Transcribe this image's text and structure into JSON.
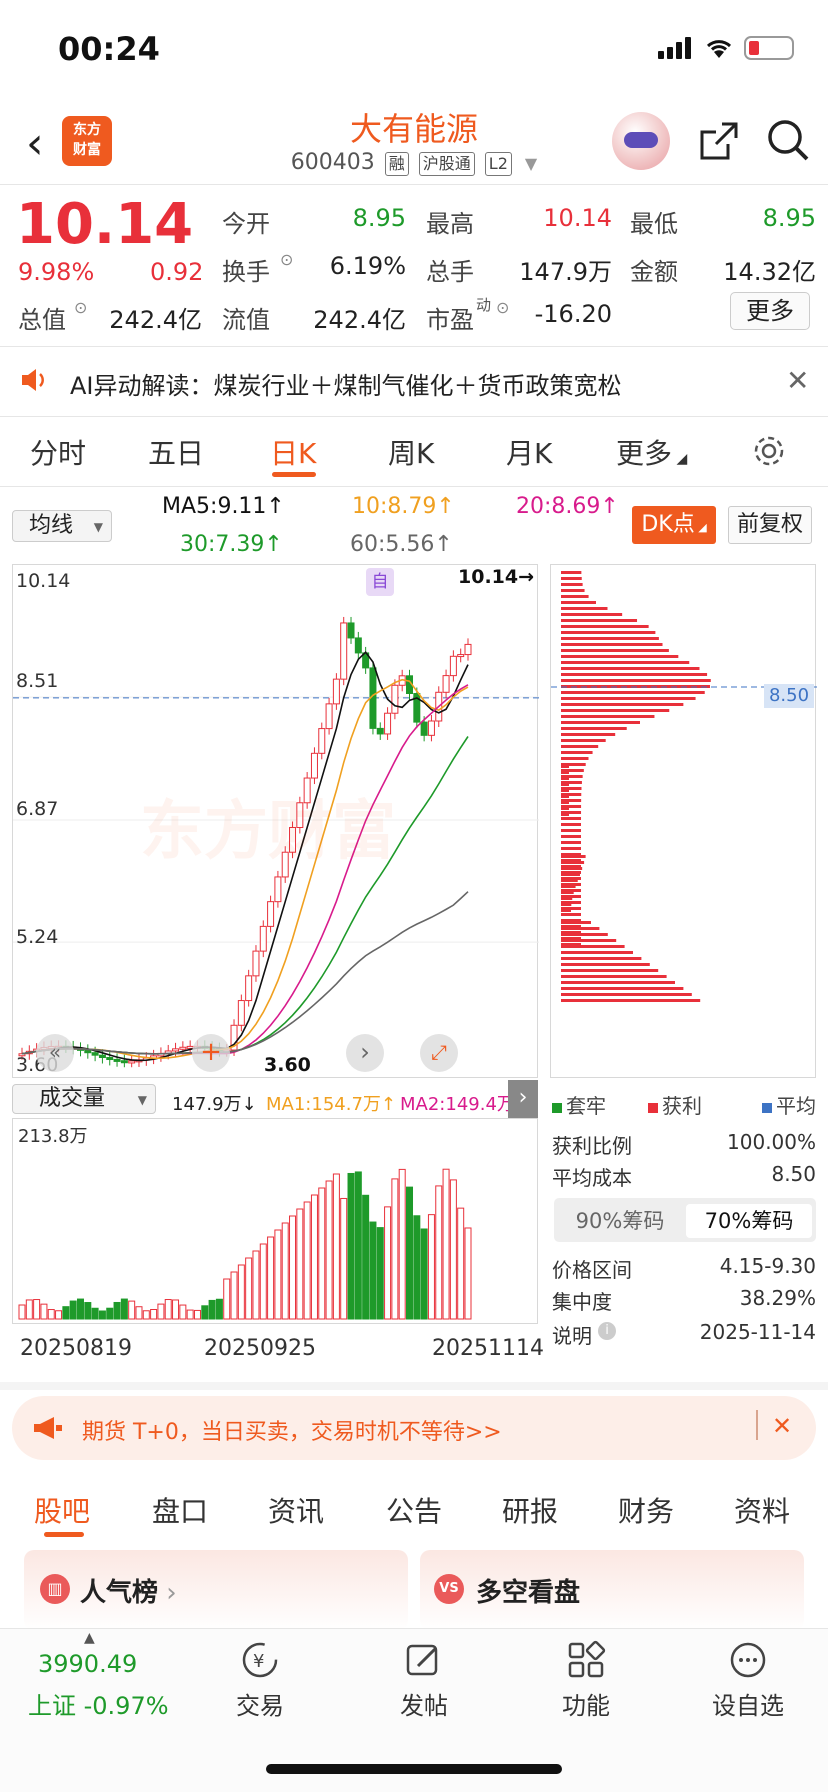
{
  "status": {
    "time": "00:24"
  },
  "header": {
    "logo_text": "东方\n财富",
    "stock_name": "大有能源",
    "stock_code": "600403",
    "tags": [
      "融",
      "沪股通",
      "L2"
    ]
  },
  "quote": {
    "price": "10.14",
    "pct": "9.98%",
    "change": "0.92",
    "open_label": "今开",
    "open": "8.95",
    "high_label": "最高",
    "high": "10.14",
    "low_label": "最低",
    "low": "8.95",
    "turnover_label": "换手",
    "turnover": "6.19%",
    "volume_label": "总手",
    "volume": "147.9万",
    "amount_label": "金额",
    "amount": "14.32亿",
    "mktcap_label": "总值",
    "mktcap": "242.4亿",
    "float_label": "流值",
    "float": "242.4亿",
    "pe_label": "市盈",
    "pe_sup": "动",
    "pe": "-16.20",
    "more_label": "更多"
  },
  "ai_banner": {
    "text": "AI异动解读：煤炭行业＋煤制气催化＋货币政策宽松"
  },
  "kline_tabs": [
    "分时",
    "五日",
    "日K",
    "周K",
    "月K",
    "更多"
  ],
  "ma": {
    "select": "均线",
    "ma5": "MA5:9.11↑",
    "ma10": "10:8.79↑",
    "ma20": "20:8.69↑",
    "ma30": "30:7.39↑",
    "ma60": "60:5.56↑",
    "dk_label": "DK点",
    "fq_label": "前复权"
  },
  "kchart": {
    "y_ticks": [
      "10.14",
      "8.51",
      "6.87",
      "5.24",
      "3.60"
    ],
    "last_label": "10.14",
    "low_label": "3.60",
    "chip_price": "8.50",
    "watermark": "东方财富",
    "marker_text": "自"
  },
  "volume": {
    "select": "成交量",
    "vol": "147.9万↓",
    "ma1": "MA1:154.7万↑",
    "ma2": "MA2:149.4万↑",
    "max_label": "213.8万",
    "dates": [
      "20250819",
      "20250925",
      "20251114"
    ]
  },
  "chip": {
    "legend": [
      "套牢",
      "获利",
      "平均"
    ],
    "rows": [
      {
        "label": "获利比例",
        "value": "100.00%"
      },
      {
        "label": "平均成本",
        "value": "8.50"
      }
    ],
    "tabs": [
      "90%筹码",
      "70%筹码"
    ],
    "rows2": [
      {
        "label": "价格区间",
        "value": "4.15-9.30"
      },
      {
        "label": "集中度",
        "value": "38.29%"
      },
      {
        "label": "说明",
        "value": "2025-11-14"
      }
    ]
  },
  "futures_banner": {
    "text": "期货 T+0，当日买卖，交易时机不等待>>"
  },
  "bottom_tabs": [
    "股吧",
    "盘口",
    "资讯",
    "公告",
    "研报",
    "财务",
    "资料"
  ],
  "cards": [
    {
      "title": "人气榜"
    },
    {
      "title": "多空看盘"
    }
  ],
  "nav": {
    "index_value": "3990.49",
    "index_label": "上证 -0.97%",
    "items": [
      "交易",
      "发帖",
      "功能",
      "设自选"
    ]
  },
  "colors": {
    "accent": "#ef5a1f",
    "up": "#e8303a",
    "down": "#1e9a2a"
  }
}
